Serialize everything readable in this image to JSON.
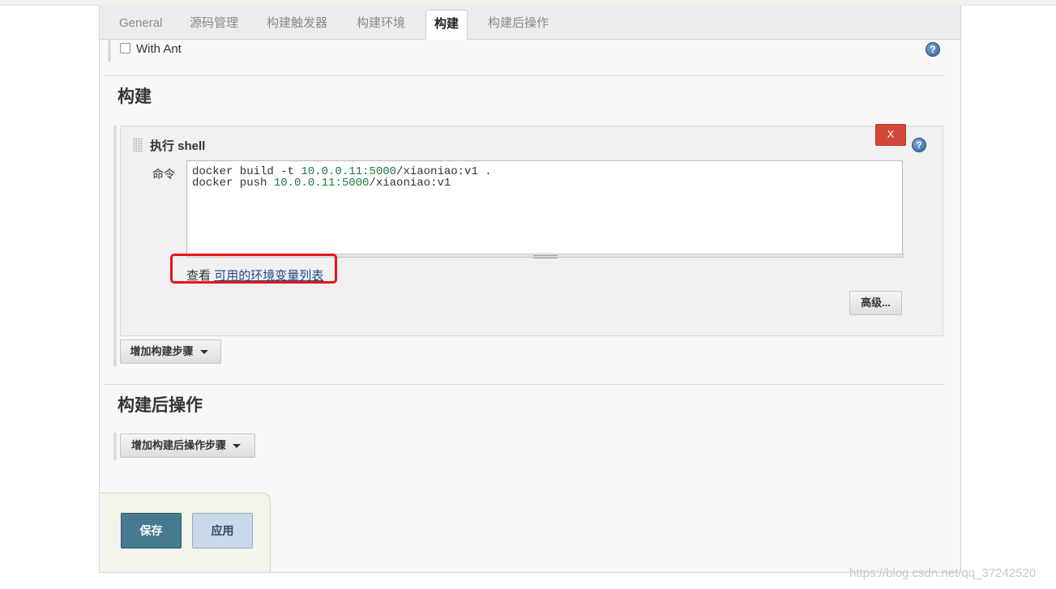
{
  "tabs": [
    {
      "label": "General"
    },
    {
      "label": "源码管理"
    },
    {
      "label": "构建触发器"
    },
    {
      "label": "构建环境"
    },
    {
      "label": "构建"
    },
    {
      "label": "构建后操作"
    }
  ],
  "active_tab": "构建",
  "with_ant": {
    "label": "With Ant",
    "checked": false
  },
  "build": {
    "title": "构建",
    "step": {
      "title": "执行 shell",
      "close_label": "X",
      "command_label": "命令",
      "command_lines": [
        "docker build -t 10.0.0.11:5000/xiaoniao:v1 .",
        "docker push 10.0.0.11:5000/xiaoniao:v1"
      ],
      "env_prefix": "查看",
      "env_link": "可用的环境变量列表",
      "advanced_label": "高级..."
    },
    "add_step_label": "增加构建步骤"
  },
  "post_build": {
    "title": "构建后操作",
    "add_step_label": "增加构建后操作步骤"
  },
  "help_glyph": "?",
  "actions": {
    "save_label": "保存",
    "apply_label": "应用"
  },
  "watermark": "https://blog.csdn.net/qq_37242520",
  "colors": {
    "save_bg": "#467a8e",
    "apply_bg": "#c9d9ea",
    "close_bg": "#d24939",
    "highlight_border": "#e8121c",
    "link": "#204a87"
  }
}
